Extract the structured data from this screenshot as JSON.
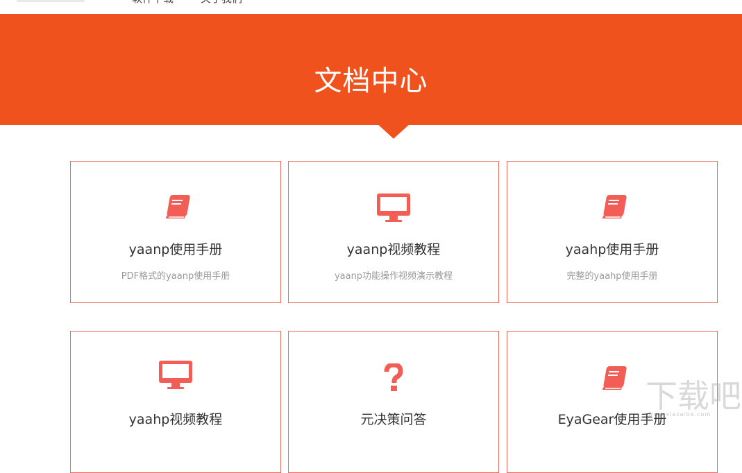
{
  "header": {
    "nav": [
      {
        "label": "软件下载"
      },
      {
        "label": "关于我们"
      }
    ]
  },
  "banner": {
    "title": "文档中心"
  },
  "colors": {
    "brand": "#ef521d",
    "card_border": "#ec6a5c",
    "icon": "#f25e55"
  },
  "cards": [
    {
      "icon": "book-icon",
      "title": "yaanp使用手册",
      "desc": "PDF格式的yaanp使用手册"
    },
    {
      "icon": "monitor-icon",
      "title": "yaanp视频教程",
      "desc": "yaanp功能操作视频演示教程"
    },
    {
      "icon": "book-icon",
      "title": "yaahp使用手册",
      "desc": "完整的yaahp使用手册"
    },
    {
      "icon": "monitor-icon",
      "title": "yaahp视频教程",
      "desc": ""
    },
    {
      "icon": "question-icon",
      "title": "元决策问答",
      "desc": ""
    },
    {
      "icon": "book-icon",
      "title": "EyaGear使用手册",
      "desc": ""
    }
  ],
  "watermark": {
    "text": "下载吧",
    "sub": "www.xiazaiba.com"
  }
}
